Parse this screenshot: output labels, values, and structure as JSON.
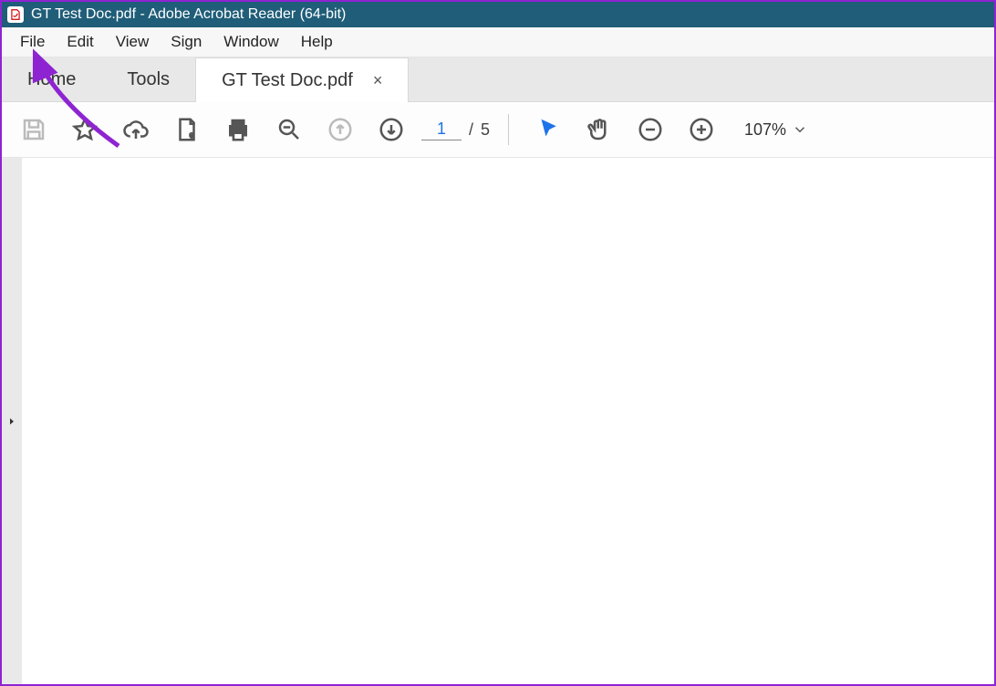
{
  "titlebar": {
    "title": "GT Test Doc.pdf - Adobe Acrobat Reader (64-bit)"
  },
  "menubar": {
    "file": "File",
    "edit": "Edit",
    "view": "View",
    "sign": "Sign",
    "window": "Window",
    "help": "Help"
  },
  "tabs": {
    "home": "Home",
    "tools": "Tools",
    "doc": "GT Test Doc.pdf",
    "close_glyph": "×"
  },
  "toolbar": {
    "page_current": "1",
    "page_sep": "/",
    "page_total": "5",
    "zoom_value": "107%"
  },
  "icons": {
    "save": "save-icon",
    "star": "star-icon",
    "cloud_upload": "cloud-upload-icon",
    "secure": "secure-doc-icon",
    "print": "print-icon",
    "find": "find-icon",
    "page_up": "page-up-icon",
    "page_down": "page-down-icon",
    "pointer": "pointer-icon",
    "hand": "hand-icon",
    "zoom_out": "zoom-out-icon",
    "zoom_in": "zoom-in-icon",
    "chevron_down": "chevron-down-icon",
    "side_expand": "expand-panel-icon"
  },
  "colors": {
    "titlebar": "#1f5d78",
    "accent": "#1e73e8",
    "annotation": "#8e24d1"
  }
}
